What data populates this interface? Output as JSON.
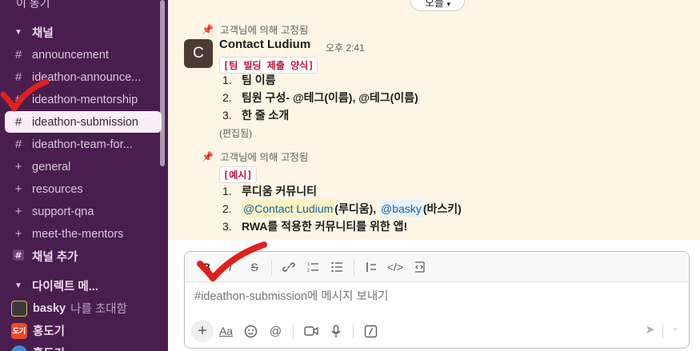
{
  "sidebar": {
    "top_partial_label": "이 동기",
    "channels_section": "채널",
    "channels": [
      {
        "name": "announcement",
        "icon": "hash-icon"
      },
      {
        "name": "ideathon-announce...",
        "icon": "hash-icon"
      },
      {
        "name": "ideathon-mentorship",
        "icon": "hash-icon"
      },
      {
        "name": "ideathon-submission",
        "icon": "hash-icon",
        "active": true
      },
      {
        "name": "ideathon-team-for...",
        "icon": "hash-icon"
      },
      {
        "name": "general",
        "icon": "plus-icon"
      },
      {
        "name": "resources",
        "icon": "plus-icon"
      },
      {
        "name": "support-qna",
        "icon": "plus-icon"
      },
      {
        "name": "meet-the-mentors",
        "icon": "plus-icon"
      }
    ],
    "add_channel": "채널 추가",
    "dm_section": "다이렉트 메...",
    "dms": [
      {
        "name": "basky",
        "note": "나를 초대함"
      },
      {
        "name": "홍도기",
        "avatar_text": "도기"
      },
      {
        "name": "홍도기"
      }
    ]
  },
  "main": {
    "top_pill": "오늘",
    "pin1": "고객님에 의해 고정됨",
    "author": "Contact Ludium",
    "avatar_letter": "C",
    "time": "오후 2:41",
    "msg1_tag": "[팀 빌딩 제출 양식]",
    "msg1_items": [
      "팀 이름",
      "팀원 구성- @테그(이름), @테그(이름)",
      "한 줄 소개"
    ],
    "edited": "(편집됨)",
    "pin2": "고객님에 의해 고정됨",
    "msg2_tag": "[예시]",
    "msg2_item1": "루디움 커뮤니티",
    "msg2_item2_mention1": "@Contact Ludium",
    "msg2_item2_text1": "(루디움),",
    "msg2_item2_mention2": "@basky",
    "msg2_item2_text2": "(바스키)",
    "msg2_item3": "RWA를 적용한 커뮤니티를 위한 앱!"
  },
  "composer": {
    "placeholder": "#ideathon-submission에 메시지 보내기",
    "format_label": "Aa"
  },
  "colors": {
    "sidebar_bg": "#4a1d4f",
    "active_bg": "#f9edf7",
    "pinned_bg": "#fdf6e6",
    "check_red": "#e0201b"
  }
}
